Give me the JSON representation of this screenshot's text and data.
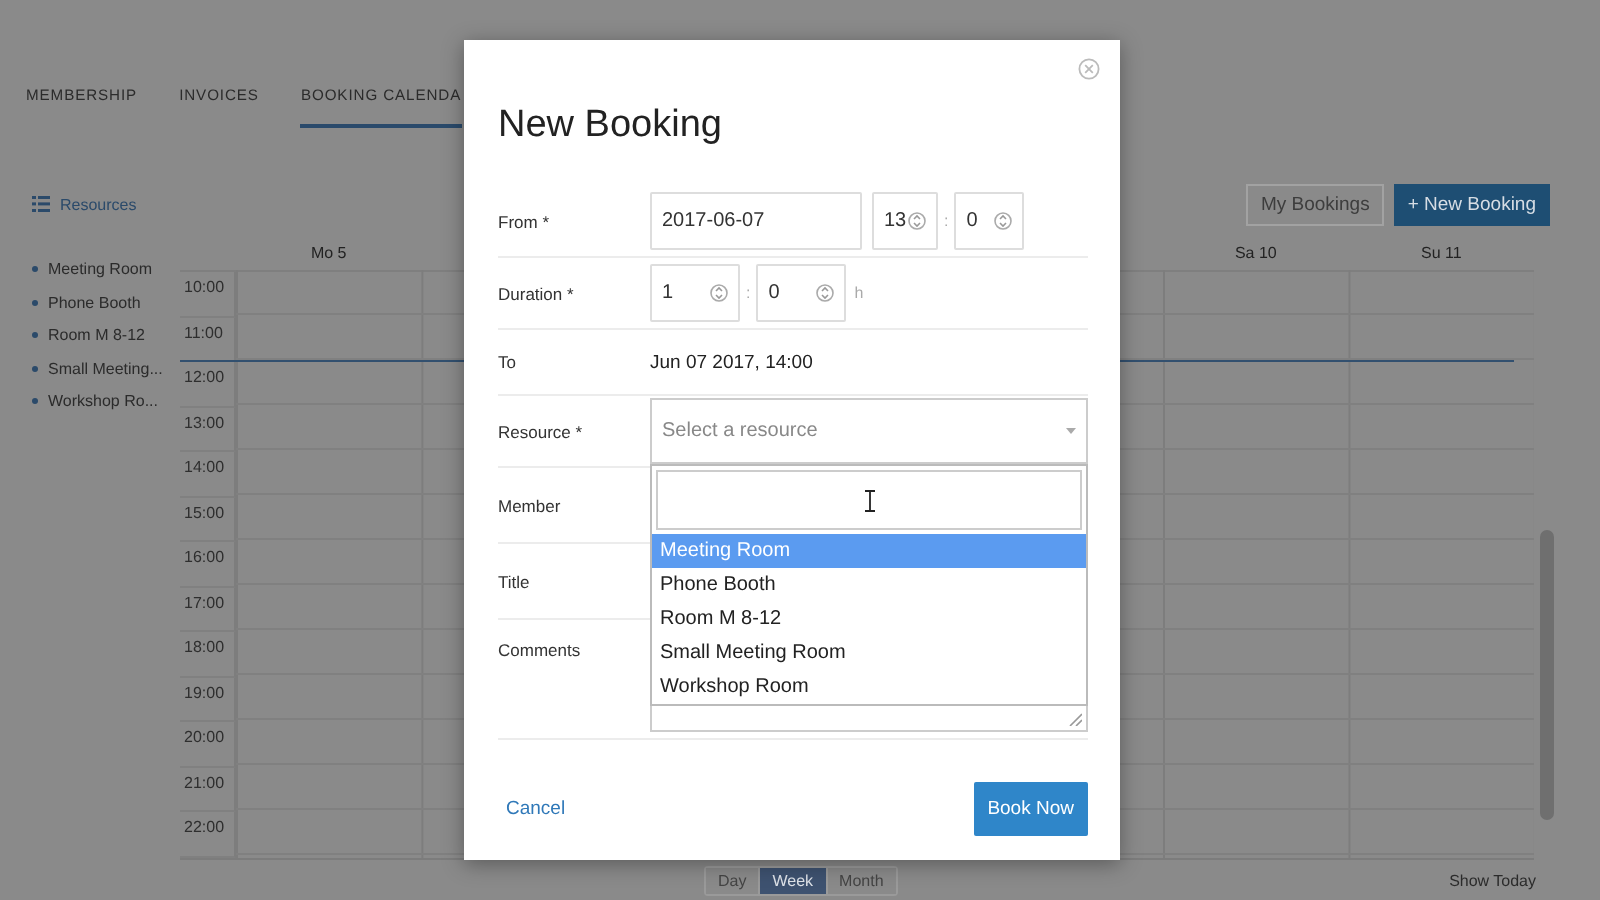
{
  "tabs": [
    {
      "label": "MEMBERSHIP",
      "selected": false
    },
    {
      "label": "INVOICES",
      "selected": false
    },
    {
      "label": "BOOKING CALENDA",
      "selected": true
    }
  ],
  "sidebar": {
    "heading": "Resources",
    "items": [
      "Meeting Room",
      "Phone Booth",
      "Room M 8-12",
      "Small Meeting...",
      "Workshop Ro..."
    ]
  },
  "toolbar": {
    "buttons": [
      {
        "label": "My Bookings",
        "kind": "secondary"
      },
      {
        "label": "+ New Booking",
        "kind": "primary"
      }
    ]
  },
  "calendar": {
    "days": [
      "Mo 5",
      "Sa 10",
      "Su 11"
    ],
    "hours": [
      "10:00",
      "11:00",
      "12:00",
      "13:00",
      "14:00",
      "15:00",
      "16:00",
      "17:00",
      "18:00",
      "19:00",
      "20:00",
      "21:00",
      "22:00"
    ]
  },
  "view_switch": [
    {
      "label": "Day",
      "selected": false
    },
    {
      "label": "Week",
      "selected": true
    },
    {
      "label": "Month",
      "selected": false
    }
  ],
  "show_today": "Show Today",
  "dialog": {
    "title": "New Booking",
    "from": {
      "label": "From *",
      "date": "2017-06-07",
      "hour": "13",
      "separator": ":",
      "minute": "0"
    },
    "duration": {
      "label": "Duration *",
      "hours": "1",
      "separator": ":",
      "minutes": "0",
      "unit": "h"
    },
    "to": {
      "label": "To",
      "value": "Jun 07 2017, 14:00"
    },
    "resource": {
      "label": "Resource *",
      "placeholder": "Select a resource",
      "expanded": true,
      "options": [
        {
          "label": "Meeting Room",
          "selected": true
        },
        {
          "label": "Phone Booth",
          "selected": false
        },
        {
          "label": "Room M 8-12",
          "selected": false
        },
        {
          "label": "Small Meeting Room",
          "selected": false
        },
        {
          "label": "Workshop Room",
          "selected": false
        }
      ]
    },
    "member": {
      "label": "Member"
    },
    "title_field": {
      "label": "Title"
    },
    "comments": {
      "label": "Comments"
    },
    "cancel": "Cancel",
    "submit": "Book Now"
  }
}
